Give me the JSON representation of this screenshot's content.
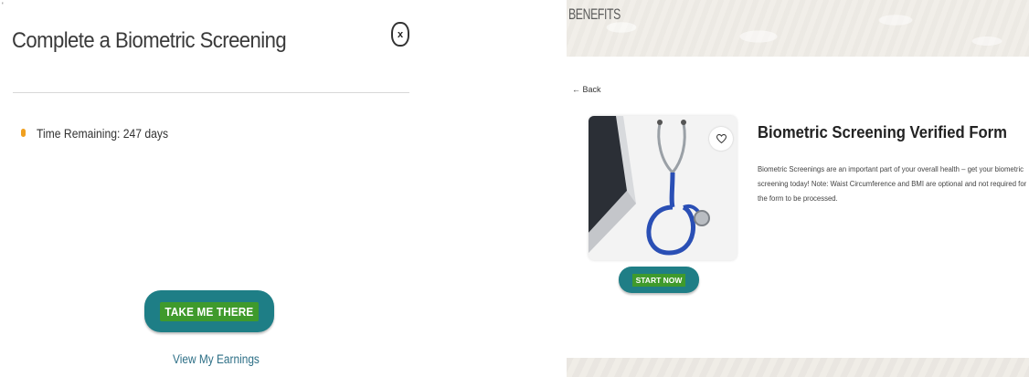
{
  "left_panel": {
    "corner_mark": "'",
    "title": "Complete a Biometric Screening",
    "close_label": "x",
    "time_remaining": "Time Remaining: 247 days",
    "take_button_label": "TAKE ME THERE",
    "earnings_link": "View My Earnings"
  },
  "right_panel": {
    "banner_title": "BENEFITS",
    "back_label": "← Back",
    "start_button_label": "START NOW",
    "form_title": "Biometric Screening Verified Form",
    "form_description": "Biometric Screenings are an important part of your overall health – get your biometric screening today! Note: Waist Circumference and BMI are optional and not required for the form to be processed."
  },
  "icons": {
    "close": "close-icon",
    "status": "status-dot",
    "favorite": "heart-icon",
    "image": "stethoscope-laptop-photo"
  },
  "colors": {
    "button_teal": "#1e7e86",
    "button_label_green": "#3f9a2c",
    "status_orange": "#f0a020",
    "link_blue": "#2d6f86"
  }
}
